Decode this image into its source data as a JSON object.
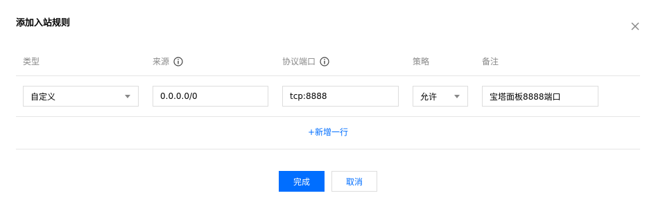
{
  "dialog": {
    "title": "添加入站规则",
    "close_icon": "close-icon"
  },
  "table": {
    "headers": {
      "type": "类型",
      "source": "来源",
      "port": "协议端口",
      "policy": "策略",
      "note": "备注"
    },
    "header_icons": {
      "source": "info-icon",
      "port": "info-icon"
    },
    "row": {
      "type_value": "自定义",
      "source_value": "0.0.0.0/0",
      "port_value": "tcp:8888",
      "policy_value": "允许",
      "note_value": "宝塔面板8888端口"
    }
  },
  "add_row_label": "+新增一行",
  "footer": {
    "confirm_label": "完成",
    "cancel_label": "取消"
  },
  "colors": {
    "accent": "#006eff",
    "header_text": "#888888",
    "border": "#dddddd",
    "divider": "#e5e5e5"
  }
}
